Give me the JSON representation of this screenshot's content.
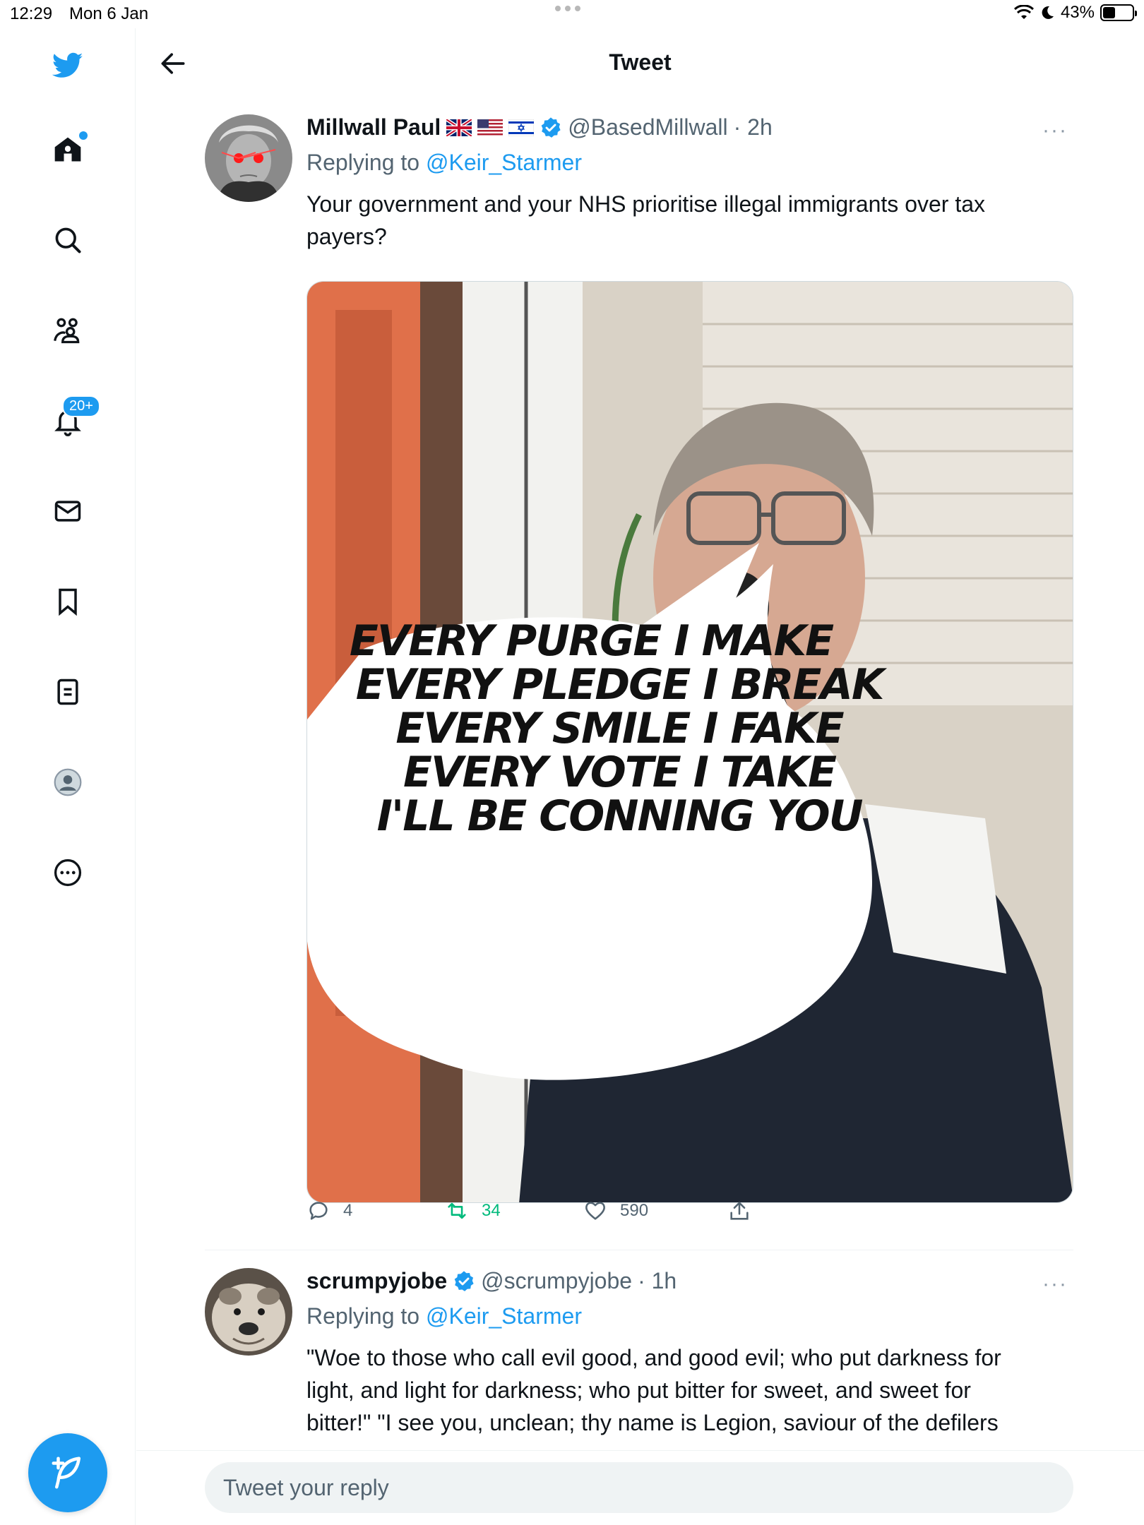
{
  "status_bar": {
    "time": "12:29",
    "date": "Mon 6 Jan",
    "battery": "43%",
    "battery_level": 0.43
  },
  "sidebar": {
    "notifications_badge": "20+"
  },
  "header": {
    "title": "Tweet"
  },
  "tweet": {
    "name": "Millwall Paul",
    "handle": "@BasedMillwall",
    "time": "· 2h",
    "reply_label": "Replying to",
    "reply_mention": "@Keir_Starmer",
    "text_line1": "Your government and your NHS prioritise illegal immigrants over tax",
    "text_line2": "payers?",
    "image_text": [
      "EVERY PURGE I MAKE",
      "EVERY PLEDGE I BREAK",
      "EVERY SMILE I FAKE",
      "EVERY VOTE I TAKE",
      "I'LL BE CONNING YOU"
    ],
    "replies": "4",
    "retweets": "34",
    "likes": "590"
  },
  "reply_tweet": {
    "name": "scrumpyjobe",
    "handle": "@scrumpyjobe",
    "time": "· 1h",
    "reply_label": "Replying to",
    "reply_mention": "@Keir_Starmer",
    "text_line1": "\"Woe to those who call evil good, and good evil; who put darkness for",
    "text_line2": "light, and light for darkness; who put bitter for sweet, and sweet for",
    "text_line3": "bitter!\"  \"I see you, unclean; thy name is Legion, saviour of the defilers"
  },
  "reply_bar": {
    "placeholder": "Tweet your reply"
  },
  "colors": {
    "accent": "#1d9bf0",
    "retweet_green": "#00ba7c",
    "muted": "#536471"
  }
}
